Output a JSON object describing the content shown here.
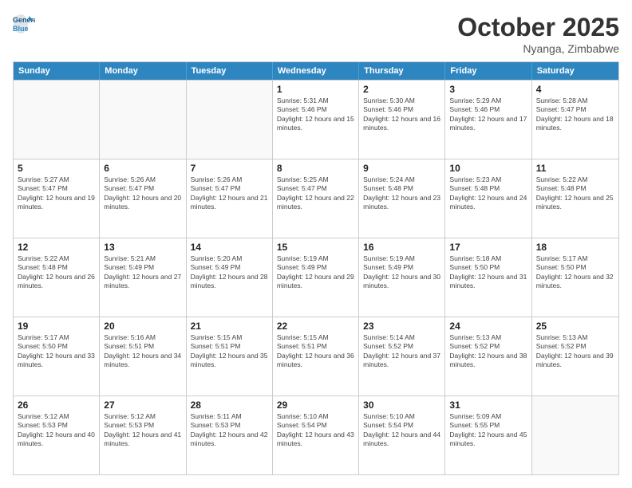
{
  "header": {
    "logo_line1": "General",
    "logo_line2": "Blue",
    "month": "October 2025",
    "location": "Nyanga, Zimbabwe"
  },
  "days_of_week": [
    "Sunday",
    "Monday",
    "Tuesday",
    "Wednesday",
    "Thursday",
    "Friday",
    "Saturday"
  ],
  "weeks": [
    [
      {
        "day": "",
        "empty": true
      },
      {
        "day": "",
        "empty": true
      },
      {
        "day": "",
        "empty": true
      },
      {
        "day": "1",
        "sunrise": "5:31 AM",
        "sunset": "5:46 PM",
        "daylight": "12 hours and 15 minutes."
      },
      {
        "day": "2",
        "sunrise": "5:30 AM",
        "sunset": "5:46 PM",
        "daylight": "12 hours and 16 minutes."
      },
      {
        "day": "3",
        "sunrise": "5:29 AM",
        "sunset": "5:46 PM",
        "daylight": "12 hours and 17 minutes."
      },
      {
        "day": "4",
        "sunrise": "5:28 AM",
        "sunset": "5:47 PM",
        "daylight": "12 hours and 18 minutes."
      }
    ],
    [
      {
        "day": "5",
        "sunrise": "5:27 AM",
        "sunset": "5:47 PM",
        "daylight": "12 hours and 19 minutes."
      },
      {
        "day": "6",
        "sunrise": "5:26 AM",
        "sunset": "5:47 PM",
        "daylight": "12 hours and 20 minutes."
      },
      {
        "day": "7",
        "sunrise": "5:26 AM",
        "sunset": "5:47 PM",
        "daylight": "12 hours and 21 minutes."
      },
      {
        "day": "8",
        "sunrise": "5:25 AM",
        "sunset": "5:47 PM",
        "daylight": "12 hours and 22 minutes."
      },
      {
        "day": "9",
        "sunrise": "5:24 AM",
        "sunset": "5:48 PM",
        "daylight": "12 hours and 23 minutes."
      },
      {
        "day": "10",
        "sunrise": "5:23 AM",
        "sunset": "5:48 PM",
        "daylight": "12 hours and 24 minutes."
      },
      {
        "day": "11",
        "sunrise": "5:22 AM",
        "sunset": "5:48 PM",
        "daylight": "12 hours and 25 minutes."
      }
    ],
    [
      {
        "day": "12",
        "sunrise": "5:22 AM",
        "sunset": "5:48 PM",
        "daylight": "12 hours and 26 minutes."
      },
      {
        "day": "13",
        "sunrise": "5:21 AM",
        "sunset": "5:49 PM",
        "daylight": "12 hours and 27 minutes."
      },
      {
        "day": "14",
        "sunrise": "5:20 AM",
        "sunset": "5:49 PM",
        "daylight": "12 hours and 28 minutes."
      },
      {
        "day": "15",
        "sunrise": "5:19 AM",
        "sunset": "5:49 PM",
        "daylight": "12 hours and 29 minutes."
      },
      {
        "day": "16",
        "sunrise": "5:19 AM",
        "sunset": "5:49 PM",
        "daylight": "12 hours and 30 minutes."
      },
      {
        "day": "17",
        "sunrise": "5:18 AM",
        "sunset": "5:50 PM",
        "daylight": "12 hours and 31 minutes."
      },
      {
        "day": "18",
        "sunrise": "5:17 AM",
        "sunset": "5:50 PM",
        "daylight": "12 hours and 32 minutes."
      }
    ],
    [
      {
        "day": "19",
        "sunrise": "5:17 AM",
        "sunset": "5:50 PM",
        "daylight": "12 hours and 33 minutes."
      },
      {
        "day": "20",
        "sunrise": "5:16 AM",
        "sunset": "5:51 PM",
        "daylight": "12 hours and 34 minutes."
      },
      {
        "day": "21",
        "sunrise": "5:15 AM",
        "sunset": "5:51 PM",
        "daylight": "12 hours and 35 minutes."
      },
      {
        "day": "22",
        "sunrise": "5:15 AM",
        "sunset": "5:51 PM",
        "daylight": "12 hours and 36 minutes."
      },
      {
        "day": "23",
        "sunrise": "5:14 AM",
        "sunset": "5:52 PM",
        "daylight": "12 hours and 37 minutes."
      },
      {
        "day": "24",
        "sunrise": "5:13 AM",
        "sunset": "5:52 PM",
        "daylight": "12 hours and 38 minutes."
      },
      {
        "day": "25",
        "sunrise": "5:13 AM",
        "sunset": "5:52 PM",
        "daylight": "12 hours and 39 minutes."
      }
    ],
    [
      {
        "day": "26",
        "sunrise": "5:12 AM",
        "sunset": "5:53 PM",
        "daylight": "12 hours and 40 minutes."
      },
      {
        "day": "27",
        "sunrise": "5:12 AM",
        "sunset": "5:53 PM",
        "daylight": "12 hours and 41 minutes."
      },
      {
        "day": "28",
        "sunrise": "5:11 AM",
        "sunset": "5:53 PM",
        "daylight": "12 hours and 42 minutes."
      },
      {
        "day": "29",
        "sunrise": "5:10 AM",
        "sunset": "5:54 PM",
        "daylight": "12 hours and 43 minutes."
      },
      {
        "day": "30",
        "sunrise": "5:10 AM",
        "sunset": "5:54 PM",
        "daylight": "12 hours and 44 minutes."
      },
      {
        "day": "31",
        "sunrise": "5:09 AM",
        "sunset": "5:55 PM",
        "daylight": "12 hours and 45 minutes."
      },
      {
        "day": "",
        "empty": true
      }
    ]
  ]
}
